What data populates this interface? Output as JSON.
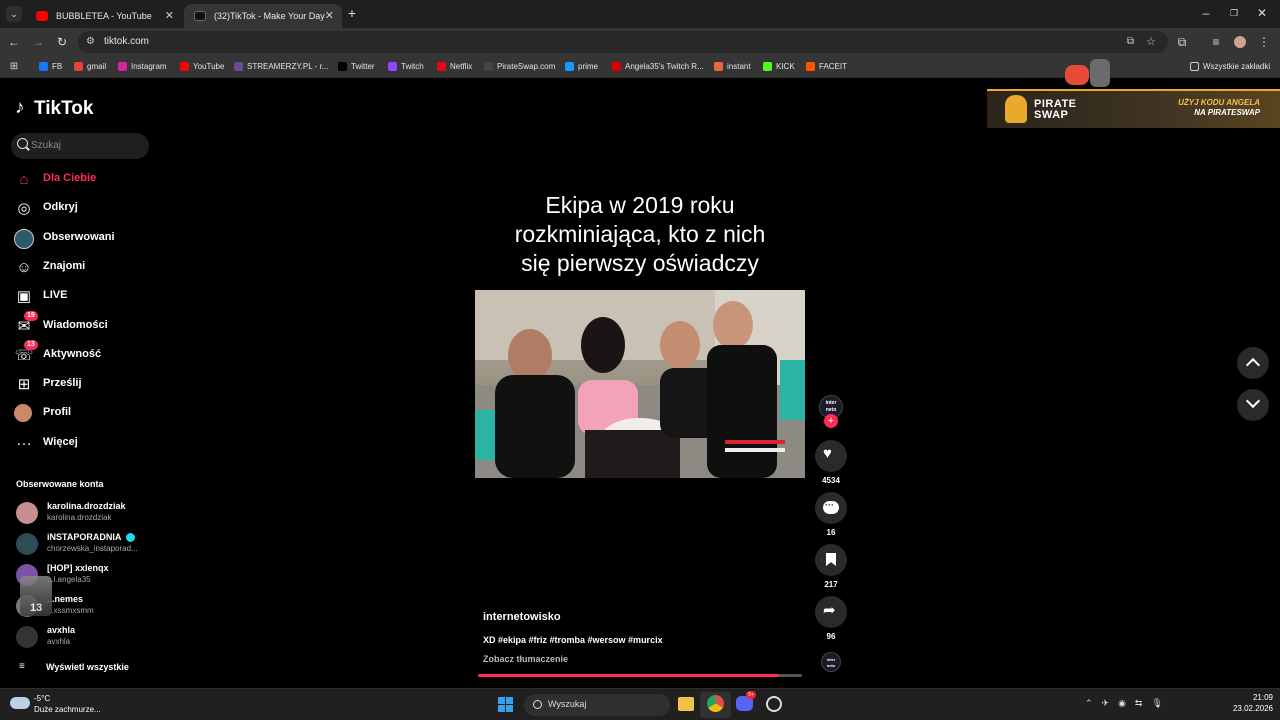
{
  "browser": {
    "tabs": [
      {
        "title": "BUBBLETEA - YouTube",
        "active": false
      },
      {
        "title": "(32)TikTok - Make Your Day",
        "active": true
      }
    ],
    "url": "tiktok.com",
    "bookmarks": [
      "FB",
      "gmail",
      "Instagram",
      "YouTube",
      "STREAMERZY.PL - r...",
      "Twitter",
      "Twitch",
      "Netflix",
      "PirateSwap.com",
      "prime",
      "Angela35's Twitch R...",
      "instant",
      "KICK",
      "FACEIT"
    ],
    "all_bookmarks_label": "Wszystkie zakładki"
  },
  "tiktok": {
    "logo": "TikTok",
    "search_placeholder": "Szukaj",
    "nav": [
      {
        "label": "Dla Ciebie",
        "active": true
      },
      {
        "label": "Odkryj"
      },
      {
        "label": "Obserwowani"
      },
      {
        "label": "Znajomi"
      },
      {
        "label": "LIVE"
      },
      {
        "label": "Wiadomości",
        "badge": "19"
      },
      {
        "label": "Aktywność",
        "badge": "13"
      },
      {
        "label": "Prześlij"
      },
      {
        "label": "Profil"
      },
      {
        "label": "Więcej"
      }
    ],
    "followed_title": "Obserwowane konta",
    "followed": [
      {
        "name": "karolina.drozdziak",
        "handle": "karolina.drozdziak"
      },
      {
        "name": "iNSTAPORADNIA",
        "handle": "chorzewska_instaporad..."
      },
      {
        "name": "[HOP] xxlenqx",
        "handle": "...l.angela35"
      },
      {
        "name": "...nemes",
        "handle": "...xssmxsmm"
      },
      {
        "name": "avxhla",
        "handle": "avxhla"
      }
    ],
    "show_all": "Wyświetl wszystkie",
    "video": {
      "caption_line1": "Ekipa w 2019 roku",
      "caption_line2": "rozkminiająca, kto z nich",
      "caption_line3": "się pierwszy oświadczy",
      "author": "internetowisko",
      "hashtags": "XD #ekipa #friz #tromba #wersow #murcix",
      "translate": "Zobacz tłumaczenie",
      "progress": 0.93
    },
    "actions": {
      "likes": "4534",
      "comments": "16",
      "saves": "217",
      "shares": "96"
    },
    "ad": {
      "brand_line1": "PIRATE",
      "brand_line2": "SWAP",
      "promo_line1": "UŻYJ KODU ANGELA",
      "promo_line2": "NA PIRATESWAP"
    }
  },
  "taskbar": {
    "temp": "-5°C",
    "weather": "Duże zachmurze...",
    "search": "Wyszukaj",
    "time": "21:09",
    "date": "23.02.2026"
  },
  "colors": {
    "accent": "#fe2c55",
    "bg": "#000000",
    "chrome": "#353535"
  }
}
